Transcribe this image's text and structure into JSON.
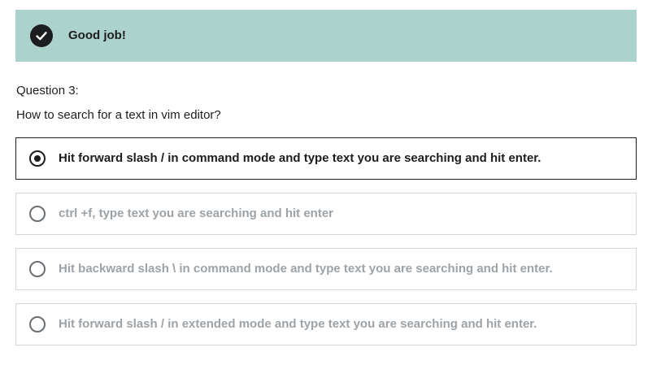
{
  "alert": {
    "icon": "check-circle-icon",
    "message": "Good job!",
    "background_color": "#acd2cc"
  },
  "question": {
    "number_label": "Question 3:",
    "prompt": "How to search for a text in vim editor?"
  },
  "options": [
    {
      "label": "Hit forward slash / in command mode and type text you are searching and hit enter.",
      "selected": true
    },
    {
      "label": "ctrl +f,  type text you are searching and hit enter",
      "selected": false
    },
    {
      "label": "Hit backward slash \\ in command mode and type text you are searching and hit enter.",
      "selected": false
    },
    {
      "label": "Hit forward slash / in extended mode and type text you are searching and hit enter.",
      "selected": false
    }
  ]
}
